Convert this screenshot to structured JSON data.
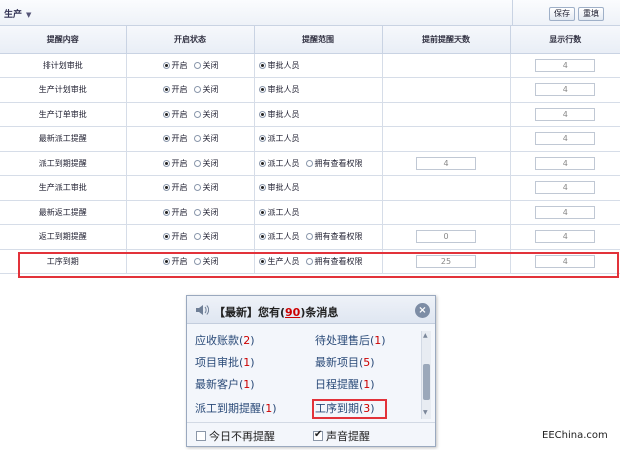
{
  "toolbar": {
    "section_title": "生产",
    "save_label": "保存",
    "reset_label": "重填"
  },
  "table": {
    "headers": [
      "提醒内容",
      "开启状态",
      "提醒范围",
      "提前提醒天数",
      "显示行数"
    ],
    "status_on": "开启",
    "status_off": "关闭",
    "view_permission": "拥有查看权限",
    "rows": [
      {
        "name": "排计划审批",
        "scope": "审批人员",
        "permission": false,
        "days": "",
        "lines": "4"
      },
      {
        "name": "生产计划审批",
        "scope": "审批人员",
        "permission": false,
        "days": "",
        "lines": "4"
      },
      {
        "name": "生产订单审批",
        "scope": "审批人员",
        "permission": false,
        "days": "",
        "lines": "4"
      },
      {
        "name": "最新派工提醒",
        "scope": "派工人员",
        "permission": false,
        "days": "",
        "lines": "4"
      },
      {
        "name": "派工到期提醒",
        "scope": "派工人员",
        "permission": true,
        "days": "4",
        "lines": "4"
      },
      {
        "name": "生产派工审批",
        "scope": "审批人员",
        "permission": false,
        "days": "",
        "lines": "4"
      },
      {
        "name": "最新返工提醒",
        "scope": "派工人员",
        "permission": false,
        "days": "",
        "lines": "4"
      },
      {
        "name": "返工到期提醒",
        "scope": "派工人员",
        "permission": true,
        "days": "0",
        "lines": "4"
      },
      {
        "name": "工序到期",
        "scope": "生产人员",
        "permission": true,
        "days": "25",
        "lines": "4"
      }
    ]
  },
  "popup": {
    "title_prefix": "【最新】您有(",
    "count": "90",
    "title_suffix": ")条消息",
    "close_label": "×",
    "items": [
      {
        "label": "应收账款",
        "count": "2"
      },
      {
        "label": "待处理售后",
        "count": "1"
      },
      {
        "label": "项目审批",
        "count": "1"
      },
      {
        "label": "最新项目",
        "count": "5"
      },
      {
        "label": "最新客户",
        "count": "1"
      },
      {
        "label": "日程提醒",
        "count": "1"
      },
      {
        "label": "派工到期提醒",
        "count": "1"
      },
      {
        "label": "工序到期",
        "count": "3"
      }
    ],
    "footer": {
      "no_remind_today": "今日不再提醒",
      "no_remind_checked": false,
      "sound_remind": "声音提醒",
      "sound_checked": true
    }
  },
  "watermark": "EEChina.com",
  "colors": {
    "highlight": "#e2323a",
    "count_text": "#cc0000",
    "link_text": "#2a4a78"
  }
}
